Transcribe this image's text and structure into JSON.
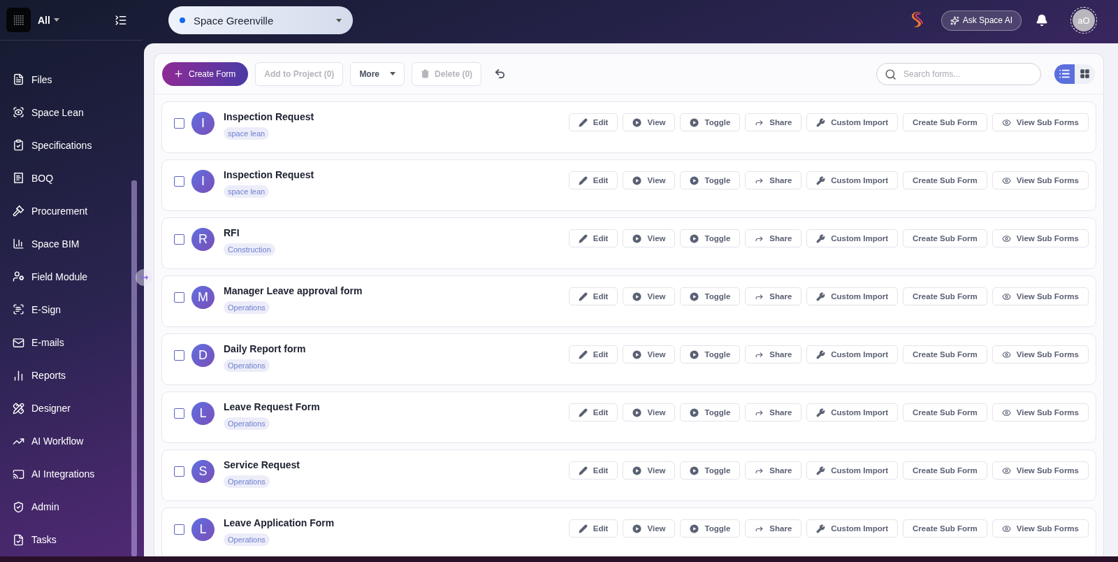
{
  "sidebar": {
    "workspace": "All",
    "items": [
      {
        "label": "Files",
        "kind": "file"
      },
      {
        "label": "Space Lean",
        "kind": "scan"
      },
      {
        "label": "Specifications",
        "kind": "checklist"
      },
      {
        "label": "BOQ",
        "kind": "receipt"
      },
      {
        "label": "Procurement",
        "kind": "gavel"
      },
      {
        "label": "Space BIM",
        "kind": "chart"
      },
      {
        "label": "Field Module",
        "kind": "usercog"
      },
      {
        "label": "E-Sign",
        "kind": "scantext"
      },
      {
        "label": "E-mails",
        "kind": "mail"
      },
      {
        "label": "Reports",
        "kind": "report"
      },
      {
        "label": "Designer",
        "kind": "designer"
      },
      {
        "label": "AI Workflow",
        "kind": "workflow"
      },
      {
        "label": "AI Integrations",
        "kind": "cast"
      },
      {
        "label": "Admin",
        "kind": "shield"
      },
      {
        "label": "Tasks",
        "kind": "tasks"
      }
    ]
  },
  "header": {
    "project": "Space Greenville",
    "ask_ai": "Ask Space AI",
    "avatar": "aO"
  },
  "toolbar": {
    "buttons": [
      {
        "label": "Create Form",
        "kind": "primary",
        "disabled": false
      },
      {
        "label": "Add to Project (0)",
        "kind": "plain",
        "disabled": true
      },
      {
        "label": "More",
        "kind": "menu",
        "disabled": false
      },
      {
        "label": "Delete (0)",
        "kind": "delete",
        "disabled": true
      }
    ],
    "search_placeholder": "Search forms...",
    "view_modes": [
      {
        "kind": "list",
        "selected": true
      },
      {
        "kind": "grid",
        "selected": false
      }
    ]
  },
  "forms": [
    {
      "initial": "I",
      "title": "Inspection Request",
      "tag": "space lean",
      "checked": false,
      "actions": [
        {
          "label": "Edit",
          "kind": "edit"
        },
        {
          "label": "View",
          "kind": "play"
        },
        {
          "label": "Toggle",
          "kind": "play"
        },
        {
          "label": "Share",
          "kind": "share"
        },
        {
          "label": "Custom Import",
          "kind": "wrench"
        },
        {
          "label": "Create Sub Form",
          "kind": "none"
        },
        {
          "label": "View Sub Forms",
          "kind": "eye"
        }
      ]
    },
    {
      "initial": "I",
      "title": "Inspection Request",
      "tag": "space lean",
      "checked": false,
      "actions": [
        {
          "label": "Edit",
          "kind": "edit"
        },
        {
          "label": "View",
          "kind": "play"
        },
        {
          "label": "Toggle",
          "kind": "play"
        },
        {
          "label": "Share",
          "kind": "share"
        },
        {
          "label": "Custom Import",
          "kind": "wrench"
        },
        {
          "label": "Create Sub Form",
          "kind": "none"
        },
        {
          "label": "View Sub Forms",
          "kind": "eye"
        }
      ]
    },
    {
      "initial": "R",
      "title": "RFI",
      "tag": "Construction",
      "checked": false,
      "actions": [
        {
          "label": "Edit",
          "kind": "edit"
        },
        {
          "label": "View",
          "kind": "play"
        },
        {
          "label": "Toggle",
          "kind": "play"
        },
        {
          "label": "Share",
          "kind": "share"
        },
        {
          "label": "Custom Import",
          "kind": "wrench"
        },
        {
          "label": "Create Sub Form",
          "kind": "none"
        },
        {
          "label": "View Sub Forms",
          "kind": "eye"
        }
      ]
    },
    {
      "initial": "M",
      "title": "Manager Leave approval form",
      "tag": "Operations",
      "checked": false,
      "actions": [
        {
          "label": "Edit",
          "kind": "edit"
        },
        {
          "label": "View",
          "kind": "play"
        },
        {
          "label": "Toggle",
          "kind": "play"
        },
        {
          "label": "Share",
          "kind": "share"
        },
        {
          "label": "Custom Import",
          "kind": "wrench"
        },
        {
          "label": "Create Sub Form",
          "kind": "none"
        },
        {
          "label": "View Sub Forms",
          "kind": "eye"
        }
      ]
    },
    {
      "initial": "D",
      "title": "Daily Report form",
      "tag": "Operations",
      "checked": false,
      "actions": [
        {
          "label": "Edit",
          "kind": "edit"
        },
        {
          "label": "View",
          "kind": "play"
        },
        {
          "label": "Toggle",
          "kind": "play"
        },
        {
          "label": "Share",
          "kind": "share"
        },
        {
          "label": "Custom Import",
          "kind": "wrench"
        },
        {
          "label": "Create Sub Form",
          "kind": "none"
        },
        {
          "label": "View Sub Forms",
          "kind": "eye"
        }
      ]
    },
    {
      "initial": "L",
      "title": "Leave Request Form",
      "tag": "Operations",
      "checked": false,
      "actions": [
        {
          "label": "Edit",
          "kind": "edit"
        },
        {
          "label": "View",
          "kind": "play"
        },
        {
          "label": "Toggle",
          "kind": "play"
        },
        {
          "label": "Share",
          "kind": "share"
        },
        {
          "label": "Custom Import",
          "kind": "wrench"
        },
        {
          "label": "Create Sub Form",
          "kind": "none"
        },
        {
          "label": "View Sub Forms",
          "kind": "eye"
        }
      ]
    },
    {
      "initial": "S",
      "title": "Service Request",
      "tag": "Operations",
      "checked": false,
      "actions": [
        {
          "label": "Edit",
          "kind": "edit"
        },
        {
          "label": "View",
          "kind": "play"
        },
        {
          "label": "Toggle",
          "kind": "play"
        },
        {
          "label": "Share",
          "kind": "share"
        },
        {
          "label": "Custom Import",
          "kind": "wrench"
        },
        {
          "label": "Create Sub Form",
          "kind": "none"
        },
        {
          "label": "View Sub Forms",
          "kind": "eye"
        }
      ]
    },
    {
      "initial": "L",
      "title": "Leave Application Form",
      "tag": "Operations",
      "checked": false,
      "actions": [
        {
          "label": "Edit",
          "kind": "edit"
        },
        {
          "label": "View",
          "kind": "play"
        },
        {
          "label": "Toggle",
          "kind": "play"
        },
        {
          "label": "Share",
          "kind": "share"
        },
        {
          "label": "Custom Import",
          "kind": "wrench"
        },
        {
          "label": "Create Sub Form",
          "kind": "none"
        },
        {
          "label": "View Sub Forms",
          "kind": "eye"
        }
      ]
    }
  ]
}
